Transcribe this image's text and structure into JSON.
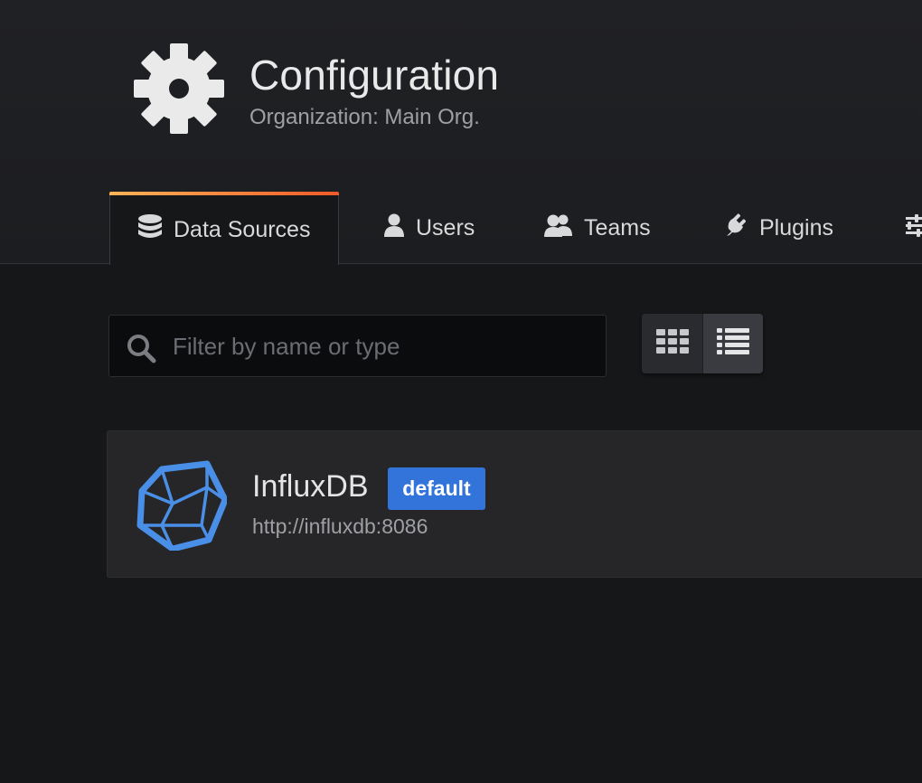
{
  "header": {
    "icon": "gear-icon",
    "title": "Configuration",
    "subtitle": "Organization: Main Org."
  },
  "tabs": [
    {
      "label": "Data Sources",
      "icon": "database-icon",
      "active": true
    },
    {
      "label": "Users",
      "icon": "user-icon",
      "active": false
    },
    {
      "label": "Teams",
      "icon": "users-icon",
      "active": false
    },
    {
      "label": "Plugins",
      "icon": "plug-icon",
      "active": false
    },
    {
      "label": "",
      "icon": "sliders-icon",
      "active": false
    }
  ],
  "toolbar": {
    "search_placeholder": "Filter by name or type",
    "search_value": "",
    "view_modes": [
      "grid-view",
      "list-view"
    ],
    "active_view": "list-view"
  },
  "datasources": [
    {
      "name": "InfluxDB",
      "url": "http://influxdb:8086",
      "badge": "default",
      "icon": "influxdb-logo-icon"
    }
  ],
  "colors": {
    "background": "#161719",
    "accent_gradient_start": "#ffb357",
    "accent_gradient_end": "#f05a28",
    "badge": "#3274d9",
    "logo": "#4a8fe7"
  }
}
